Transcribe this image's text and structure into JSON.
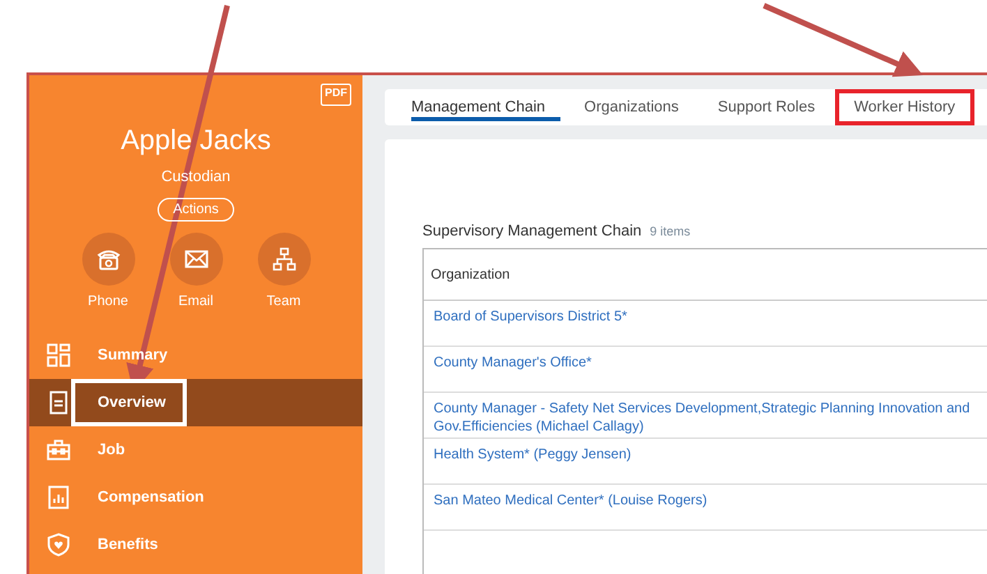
{
  "profile": {
    "name": "Apple Jacks",
    "job_title": "Custodian",
    "actions_button": "Actions",
    "pdf_label": "PDF"
  },
  "contact_actions": [
    {
      "label": "Phone",
      "kind": "phone"
    },
    {
      "label": "Email",
      "kind": "email"
    },
    {
      "label": "Team",
      "kind": "team"
    }
  ],
  "nav": [
    {
      "label": "Summary",
      "kind": "summary",
      "selected": false,
      "highlighted": false
    },
    {
      "label": "Overview",
      "kind": "overview",
      "selected": true,
      "highlighted": true
    },
    {
      "label": "Job",
      "kind": "job",
      "selected": false,
      "highlighted": false
    },
    {
      "label": "Compensation",
      "kind": "compensation",
      "selected": false,
      "highlighted": false
    },
    {
      "label": "Benefits",
      "kind": "benefits",
      "selected": false,
      "highlighted": false
    }
  ],
  "tabs": [
    {
      "label": "Management Chain",
      "selected": true,
      "highlighted": false
    },
    {
      "label": "Organizations",
      "selected": false,
      "highlighted": false
    },
    {
      "label": "Support Roles",
      "selected": false,
      "highlighted": false
    },
    {
      "label": "Worker History",
      "selected": false,
      "highlighted": true
    }
  ],
  "section": {
    "title": "Supervisory Management Chain",
    "count": "9 items",
    "column": "Organization",
    "rows": [
      "Board of Supervisors District 5*",
      "County Manager's Office*",
      "County Manager - Safety Net Services Development,Strategic Planning Innovation and Gov.Efficiencies (Michael Callagy)",
      "Health System* (Peggy Jensen)",
      "San Mateo Medical Center* (Louise Rogers)"
    ]
  }
}
